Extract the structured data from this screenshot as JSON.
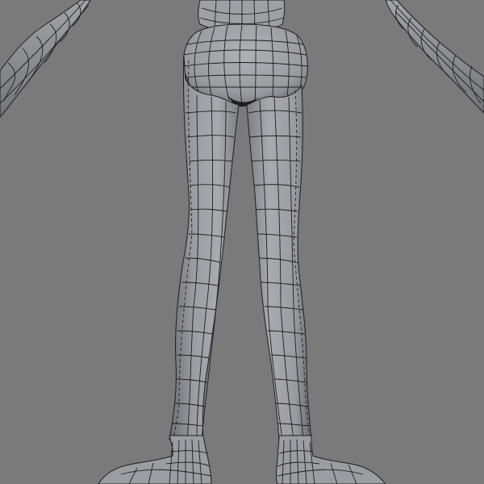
{
  "viewport": {
    "background_color": "#7a7a7a",
    "mesh_fill_color": "#a7a8ae",
    "mesh_shadow_color": "#6c6d73",
    "wire_color": "#1e1e1e"
  }
}
